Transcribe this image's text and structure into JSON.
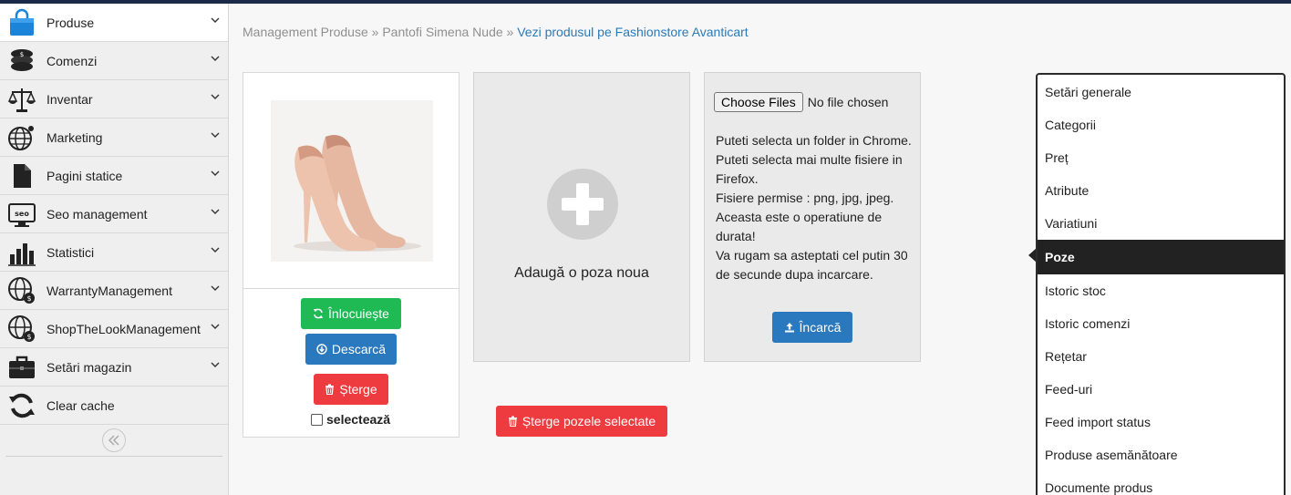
{
  "sidebar": {
    "items": [
      {
        "label": "Produse",
        "icon": "shopping-bag-icon"
      },
      {
        "label": "Comenzi",
        "icon": "coins-icon"
      },
      {
        "label": "Inventar",
        "icon": "balance-scale-icon"
      },
      {
        "label": "Marketing",
        "icon": "globe-network-icon"
      },
      {
        "label": "Pagini statice",
        "icon": "file-icon"
      },
      {
        "label": "Seo management",
        "icon": "seo-monitor-icon"
      },
      {
        "label": "Statistici",
        "icon": "bar-chart-icon"
      },
      {
        "label": "WarrantyManagement",
        "icon": "globe-dollar-icon"
      },
      {
        "label": "ShopTheLookManagement",
        "icon": "globe-dollar-icon"
      },
      {
        "label": "Setări magazin",
        "icon": "briefcase-icon"
      },
      {
        "label": "Clear cache",
        "icon": "refresh-icon"
      }
    ],
    "active_index": 0,
    "collapse_icon": "double-chevron-left-icon"
  },
  "breadcrumb": {
    "part1": "Management Produse",
    "sep1": " » ",
    "part2": "Pantofi Simena Nude",
    "sep2": " » ",
    "link": "Vezi produsul pe Fashionstore Avanticart"
  },
  "image_card": {
    "image_alt": "Pantofi Simena Nude",
    "replace_label": "Înlocuiește",
    "download_label": "Descarcă",
    "delete_label": "Șterge",
    "select_label": "selectează"
  },
  "add_card": {
    "label": "Adaugă o poza noua"
  },
  "upload_card": {
    "choose_files_label": "Choose Files",
    "no_file_label": "No file chosen",
    "info": [
      "Puteti selecta un folder in Chrome.",
      "Puteti selecta mai multe fisiere in Firefox.",
      "Fisiere permise : png, jpg, jpeg.",
      "Aceasta este o operatiune de durata!",
      "Va rugam sa asteptati cel putin 30 de secunde dupa incarcare."
    ],
    "upload_label": "Încarcă"
  },
  "delete_selected_label": "Șterge pozele selectate",
  "tabs": {
    "items": [
      "Setări generale",
      "Categorii",
      "Preț",
      "Atribute",
      "Variatiuni",
      "Poze",
      "Istoric stoc",
      "Istoric comenzi",
      "Rețetar",
      "Feed-uri",
      "Feed import status",
      "Produse asemănătoare",
      "Documente produs"
    ],
    "active_index": 5
  },
  "colors": {
    "green": "#1fba54",
    "blue": "#2a78bd",
    "red": "#ee3b3f",
    "link": "#2a7ab8",
    "active_tab": "#222222"
  }
}
